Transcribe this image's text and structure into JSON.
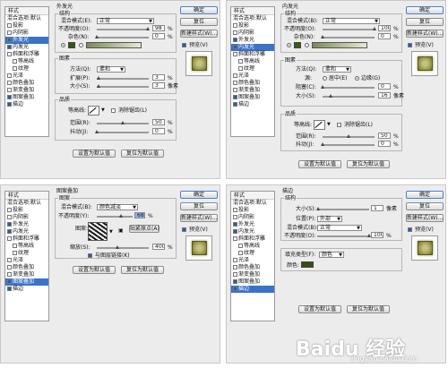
{
  "common": {
    "styles_title": "样式",
    "blend_default": "混合选项:默认",
    "buttons": {
      "ok": "确定",
      "reset": "复位",
      "new_style": "新建样式(W)...",
      "preview": "预览(V)",
      "make_default": "设置为默认值",
      "reset_default": "复位为默认值"
    }
  },
  "panels": [
    {
      "sidebar": [
        {
          "label": "投影",
          "checked": false,
          "selected": false,
          "indent": false
        },
        {
          "label": "内阴影",
          "checked": false,
          "selected": false,
          "indent": false
        },
        {
          "label": "外发光",
          "checked": true,
          "selected": true,
          "indent": false
        },
        {
          "label": "内发光",
          "checked": true,
          "selected": false,
          "indent": false
        },
        {
          "label": "斜面和浮雕",
          "checked": false,
          "selected": false,
          "indent": false
        },
        {
          "label": "等高线",
          "checked": false,
          "selected": false,
          "indent": true
        },
        {
          "label": "纹理",
          "checked": false,
          "selected": false,
          "indent": true
        },
        {
          "label": "光泽",
          "checked": false,
          "selected": false,
          "indent": false
        },
        {
          "label": "颜色叠加",
          "checked": false,
          "selected": false,
          "indent": false
        },
        {
          "label": "渐变叠加",
          "checked": false,
          "selected": false,
          "indent": false
        },
        {
          "label": "图案叠加",
          "checked": true,
          "selected": false,
          "indent": false
        },
        {
          "label": "描边",
          "checked": true,
          "selected": false,
          "indent": false
        }
      ],
      "title": "外发光",
      "structure": {
        "legend": "结构",
        "blend_mode_label": "混合模式(E):",
        "blend_mode": "正常",
        "opacity_label": "不透明度(O):",
        "opacity": "98",
        "opacity_level": 0.98,
        "noise_label": "杂色(N):",
        "noise": "0",
        "noise_level": 0.0,
        "glow_color": "#2e5a12"
      },
      "elements": {
        "legend": "图素",
        "technique_label": "方法(Q):",
        "technique": "柔和",
        "spread_label": "扩展(P):",
        "spread": "3",
        "spread_level": 0.03,
        "size_label": "大小(S):",
        "size": "3",
        "size_level": 0.03,
        "size_unit": "像素"
      },
      "quality": {
        "legend": "品质",
        "contour_label": "等高线:",
        "antialias_label": "消除锯齿(L)",
        "range_label": "范围(R):",
        "range": "50",
        "range_level": 0.5,
        "jitter_label": "抖动(J):",
        "jitter": "0",
        "jitter_level": 0.0
      }
    },
    {
      "sidebar": [
        {
          "label": "投影",
          "checked": false,
          "selected": false,
          "indent": false
        },
        {
          "label": "内阴影",
          "checked": false,
          "selected": false,
          "indent": false
        },
        {
          "label": "外发光",
          "checked": true,
          "selected": false,
          "indent": false
        },
        {
          "label": "内发光",
          "checked": true,
          "selected": true,
          "indent": false
        },
        {
          "label": "斜面和浮雕",
          "checked": false,
          "selected": false,
          "indent": false
        },
        {
          "label": "等高线",
          "checked": false,
          "selected": false,
          "indent": true
        },
        {
          "label": "纹理",
          "checked": false,
          "selected": false,
          "indent": true
        },
        {
          "label": "光泽",
          "checked": false,
          "selected": false,
          "indent": false
        },
        {
          "label": "颜色叠加",
          "checked": false,
          "selected": false,
          "indent": false
        },
        {
          "label": "渐变叠加",
          "checked": false,
          "selected": false,
          "indent": false
        },
        {
          "label": "图案叠加",
          "checked": true,
          "selected": false,
          "indent": false
        },
        {
          "label": "描边",
          "checked": true,
          "selected": false,
          "indent": false
        }
      ],
      "title": "内发光",
      "structure": {
        "legend": "结构",
        "blend_mode_label": "混合模式(B):",
        "blend_mode": "正常",
        "opacity_label": "不透明度(O):",
        "opacity": "100",
        "opacity_level": 1.0,
        "noise_label": "杂色(N):",
        "noise": "0",
        "noise_level": 0.0,
        "glow_color": "#3d5a14"
      },
      "elements": {
        "legend": "图素",
        "technique_label": "方法(Q):",
        "technique": "柔和",
        "source_label": "源:",
        "center_label": "居中(E)",
        "edge_label": "边缘(G)",
        "choke_label": "阻塞(C):",
        "choke": "0",
        "choke_level": 0.0,
        "size_label": "大小(S):",
        "size": "16",
        "size_level": 0.16,
        "size_unit": "像素"
      },
      "quality": {
        "legend": "品质",
        "contour_label": "等高线:",
        "antialias_label": "消除锯齿(L)",
        "range_label": "范围(R):",
        "range": "50",
        "range_level": 0.5,
        "jitter_label": "抖动(J):",
        "jitter": "0",
        "jitter_level": 0.0
      }
    },
    {
      "sidebar": [
        {
          "label": "投影",
          "checked": false,
          "selected": false,
          "indent": false
        },
        {
          "label": "内阴影",
          "checked": false,
          "selected": false,
          "indent": false
        },
        {
          "label": "外发光",
          "checked": true,
          "selected": false,
          "indent": false
        },
        {
          "label": "内发光",
          "checked": true,
          "selected": false,
          "indent": false
        },
        {
          "label": "斜面和浮雕",
          "checked": false,
          "selected": false,
          "indent": false
        },
        {
          "label": "等高线",
          "checked": false,
          "selected": false,
          "indent": true
        },
        {
          "label": "纹理",
          "checked": false,
          "selected": false,
          "indent": true
        },
        {
          "label": "光泽",
          "checked": false,
          "selected": false,
          "indent": false
        },
        {
          "label": "颜色叠加",
          "checked": false,
          "selected": false,
          "indent": false
        },
        {
          "label": "渐变叠加",
          "checked": false,
          "selected": false,
          "indent": false
        },
        {
          "label": "图案叠加",
          "checked": true,
          "selected": true,
          "indent": false
        },
        {
          "label": "描边",
          "checked": true,
          "selected": false,
          "indent": false
        }
      ],
      "title": "图案叠加",
      "pattern": {
        "legend": "图案",
        "blend_mode_label": "混合模式(B):",
        "blend_mode": "颜色减淡",
        "opacity_label": "不透明度(Y):",
        "opacity": "68",
        "opacity_level": 0.68,
        "pattern_label": "图案:",
        "snap_origin": "贴紧原点(A)",
        "scale_label": "缩放(S):",
        "scale": "400",
        "scale_level": 0.4,
        "link_label": "与图层链接(K)"
      }
    },
    {
      "sidebar": [
        {
          "label": "投影",
          "checked": false,
          "selected": false,
          "indent": false
        },
        {
          "label": "内阴影",
          "checked": false,
          "selected": false,
          "indent": false
        },
        {
          "label": "外发光",
          "checked": true,
          "selected": false,
          "indent": false
        },
        {
          "label": "内发光",
          "checked": true,
          "selected": false,
          "indent": false
        },
        {
          "label": "斜面和浮雕",
          "checked": false,
          "selected": false,
          "indent": false
        },
        {
          "label": "等高线",
          "checked": false,
          "selected": false,
          "indent": true
        },
        {
          "label": "纹理",
          "checked": false,
          "selected": false,
          "indent": true
        },
        {
          "label": "光泽",
          "checked": false,
          "selected": false,
          "indent": false
        },
        {
          "label": "颜色叠加",
          "checked": false,
          "selected": false,
          "indent": false
        },
        {
          "label": "渐变叠加",
          "checked": false,
          "selected": false,
          "indent": false
        },
        {
          "label": "图案叠加",
          "checked": true,
          "selected": false,
          "indent": false
        },
        {
          "label": "描边",
          "checked": true,
          "selected": true,
          "indent": false
        }
      ],
      "title": "描边",
      "stroke": {
        "legend": "结构",
        "size_label": "大小(S):",
        "size": "1",
        "size_level": 0.01,
        "size_unit": "像素",
        "position_label": "位置(P):",
        "position": "外部",
        "blend_mode_label": "混合模式(B):",
        "blend_mode": "正常",
        "opacity_label": "不透明度(O):",
        "opacity": "100",
        "opacity_level": 1.0,
        "fill_type_label": "填充类型(F):",
        "fill_type": "颜色",
        "color_label": "颜色:",
        "color": "#3a4d12"
      }
    }
  ],
  "watermark": {
    "text": "Baidu 经验",
    "url": "jingyan.baidu.com"
  }
}
